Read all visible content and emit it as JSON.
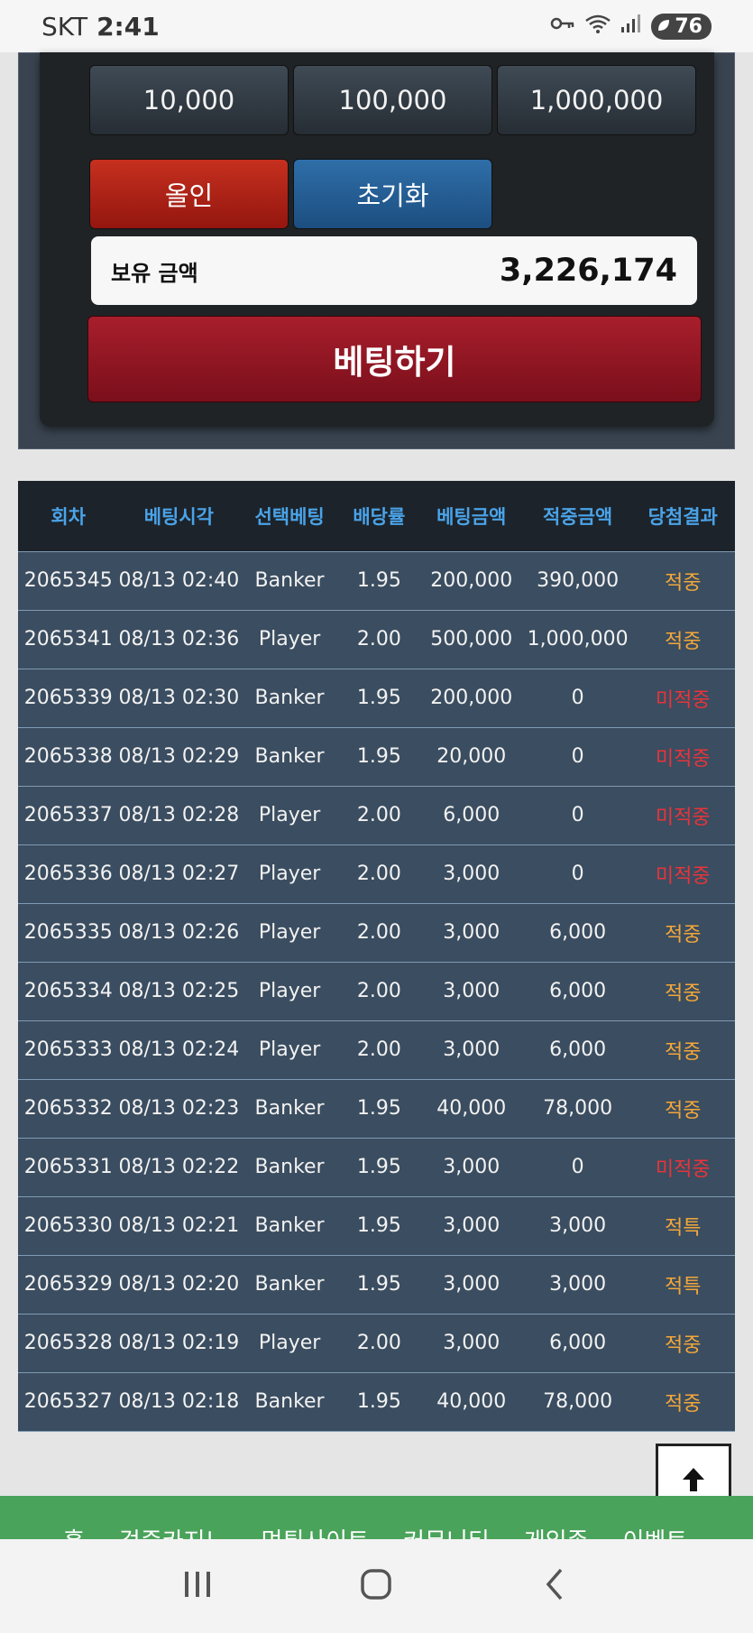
{
  "status_bar": {
    "carrier": "SKT",
    "time": "2:41",
    "battery": "76"
  },
  "chips": [
    "10,000",
    "100,000",
    "1,000,000"
  ],
  "buttons": {
    "all_in": "올인",
    "reset": "초기화",
    "bet": "베팅하기"
  },
  "balance": {
    "label": "보유 금액",
    "amount": "3,226,174"
  },
  "history": {
    "headers": [
      "회차",
      "베팅시각",
      "선택베팅",
      "배당률",
      "베팅금액",
      "적중금액",
      "당첨결과"
    ],
    "rows": [
      [
        "2065345",
        "08/13 02:40",
        "Banker",
        "1.95",
        "200,000",
        "390,000",
        "적중"
      ],
      [
        "2065341",
        "08/13 02:36",
        "Player",
        "2.00",
        "500,000",
        "1,000,000",
        "적중"
      ],
      [
        "2065339",
        "08/13 02:30",
        "Banker",
        "1.95",
        "200,000",
        "0",
        "미적중"
      ],
      [
        "2065338",
        "08/13 02:29",
        "Banker",
        "1.95",
        "20,000",
        "0",
        "미적중"
      ],
      [
        "2065337",
        "08/13 02:28",
        "Player",
        "2.00",
        "6,000",
        "0",
        "미적중"
      ],
      [
        "2065336",
        "08/13 02:27",
        "Player",
        "2.00",
        "3,000",
        "0",
        "미적중"
      ],
      [
        "2065335",
        "08/13 02:26",
        "Player",
        "2.00",
        "3,000",
        "6,000",
        "적중"
      ],
      [
        "2065334",
        "08/13 02:25",
        "Player",
        "2.00",
        "3,000",
        "6,000",
        "적중"
      ],
      [
        "2065333",
        "08/13 02:24",
        "Player",
        "2.00",
        "3,000",
        "6,000",
        "적중"
      ],
      [
        "2065332",
        "08/13 02:23",
        "Banker",
        "1.95",
        "40,000",
        "78,000",
        "적중"
      ],
      [
        "2065331",
        "08/13 02:22",
        "Banker",
        "1.95",
        "3,000",
        "0",
        "미적중"
      ],
      [
        "2065330",
        "08/13 02:21",
        "Banker",
        "1.95",
        "3,000",
        "3,000",
        "적특"
      ],
      [
        "2065329",
        "08/13 02:20",
        "Banker",
        "1.95",
        "3,000",
        "3,000",
        "적특"
      ],
      [
        "2065328",
        "08/13 02:19",
        "Player",
        "2.00",
        "3,000",
        "6,000",
        "적중"
      ],
      [
        "2065327",
        "08/13 02:18",
        "Banker",
        "1.95",
        "40,000",
        "78,000",
        "적중"
      ]
    ]
  },
  "footer_nav": [
    "홈",
    "검증카지노",
    "먹튀사이트",
    "커뮤니티",
    "게임존",
    "이벤트"
  ],
  "colors": {
    "hit": "#f3a73a",
    "miss": "#e8343a",
    "header_text": "#4aa3e8",
    "footer_bg": "#4aa35a"
  }
}
